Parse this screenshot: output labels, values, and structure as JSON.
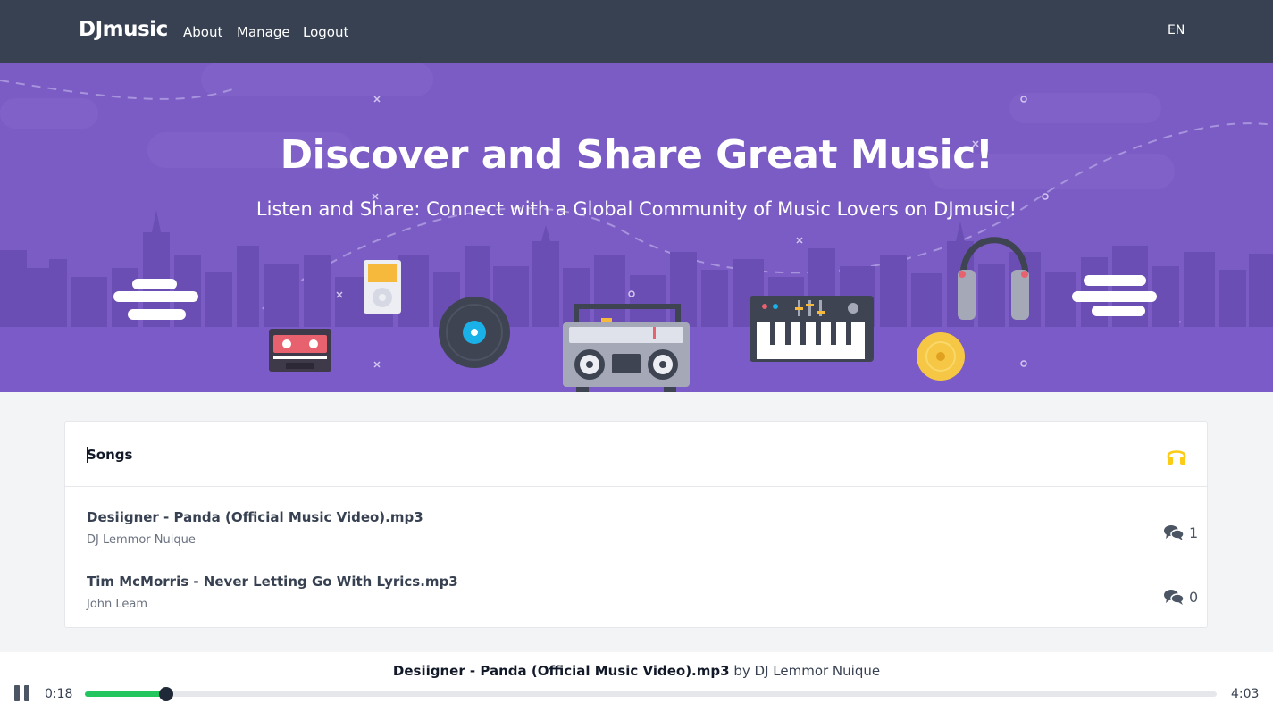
{
  "nav": {
    "brand": "DJmusic",
    "links": [
      "About",
      "Manage",
      "Logout"
    ],
    "language": "EN"
  },
  "hero": {
    "title": "Discover and Share Great Music!",
    "subtitle": "Listen and Share: Connect with a Global Community of Music Lovers on DJmusic!"
  },
  "songs": {
    "title": "Songs",
    "header_icon": "headphones-icon",
    "accent": "#facc15",
    "items": [
      {
        "title": "Desiigner - Panda (Official Music Video).mp3",
        "artist": "DJ Lemmor Nuique",
        "comments": "1"
      },
      {
        "title": "Tim McMorris - Never Letting Go With Lyrics.mp3",
        "artist": "John Leam",
        "comments": "0"
      }
    ]
  },
  "player": {
    "track_title": "Desiigner - Panda (Official Music Video).mp3",
    "by": "by",
    "artist": "DJ Lemmor Nuique",
    "current_time": "0:18",
    "total_time": "4:03",
    "progress": 0.072,
    "progress_color": "#22c55e",
    "state": "playing"
  }
}
